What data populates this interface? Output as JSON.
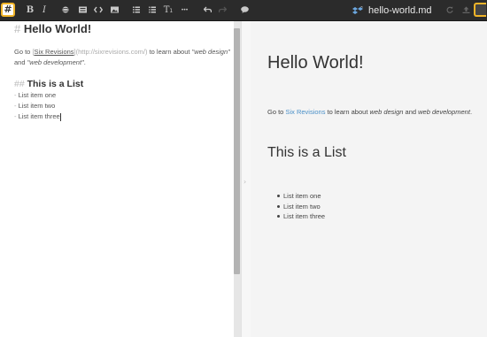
{
  "toolbar": {
    "logo_glyph": "#",
    "bold_label": "B",
    "italic_label": "I",
    "heading_label": "T",
    "heading_sub": "1",
    "more_label": "•••",
    "file_title": "hello-world.md",
    "icons": [
      "bold-icon",
      "italic-icon",
      "globe-icon",
      "blockquote-icon",
      "code-icon",
      "image-icon",
      "ordered-list-icon",
      "unordered-list-icon",
      "heading-icon",
      "more-icon",
      "undo-icon",
      "redo-icon",
      "comment-icon",
      "dropbox-icon",
      "sync-icon",
      "publish-icon"
    ],
    "accent_color": "#f0b429",
    "background_color": "#2b2b2b"
  },
  "editor": {
    "h1_hash": "#",
    "h1_text": "Hello World!",
    "para_pre": "Go to ",
    "para_bracket_open": "[",
    "para_link_text": "Six Revisions",
    "para_bracket_close": "]",
    "para_url": "(http://sixrevisions.com/)",
    "para_mid": " to learn about ",
    "para_em1": "\"web design\"",
    "para_and": " and ",
    "para_em2": "\"web development\"",
    "para_end": ".",
    "h2_hash": "##",
    "h2_text": "This is a List",
    "list_dash": "-",
    "list_items": [
      "List item one",
      "List item two",
      "List item three"
    ]
  },
  "preview": {
    "h1": "Hello World!",
    "para_pre": "Go to ",
    "para_link": "Six Revisions",
    "para_mid": " to learn about ",
    "para_em1": "web design",
    "para_and": " and ",
    "para_em2": "web development",
    "para_end": ".",
    "h2": "This is a List",
    "list_items": [
      "List item one",
      "List item two",
      "List item three"
    ],
    "link_color": "#4a90c8"
  },
  "splitter": {
    "arrow_glyph": "›"
  }
}
